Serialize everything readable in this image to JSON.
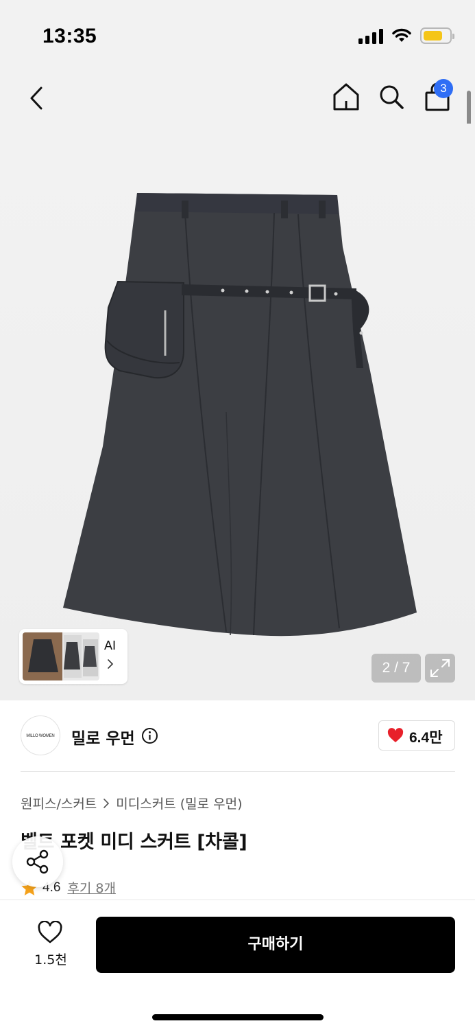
{
  "status_bar": {
    "time": "13:35"
  },
  "nav": {
    "cart_count": "3"
  },
  "gallery": {
    "ai_label": "AI",
    "counter": "2 / 7"
  },
  "brand": {
    "name": "밀로 우먼",
    "logo_text": "MILLO WOMEN",
    "like_count": "6.4만"
  },
  "breadcrumb": {
    "items": [
      "원피스/스커트",
      "미디스커트 (밀로 우먼)"
    ]
  },
  "product": {
    "title": "벨트 포켓 미디 스커트 [차콜]",
    "rating": "4.6",
    "review_text": "후기 8개"
  },
  "bottom_bar": {
    "wish_count": "1.5천",
    "buy_label": "구매하기"
  },
  "colors": {
    "accent_badge": "#2f6ef5",
    "heart": "#e8202a",
    "star": "#f5a21b",
    "buy_button": "#000000"
  },
  "icons": [
    "back-arrow-icon",
    "home-icon",
    "search-icon",
    "shopping-bag-icon",
    "chevron-right-icon",
    "expand-icon",
    "info-icon",
    "heart-filled-icon",
    "star-icon",
    "share-icon",
    "heart-outline-icon"
  ]
}
